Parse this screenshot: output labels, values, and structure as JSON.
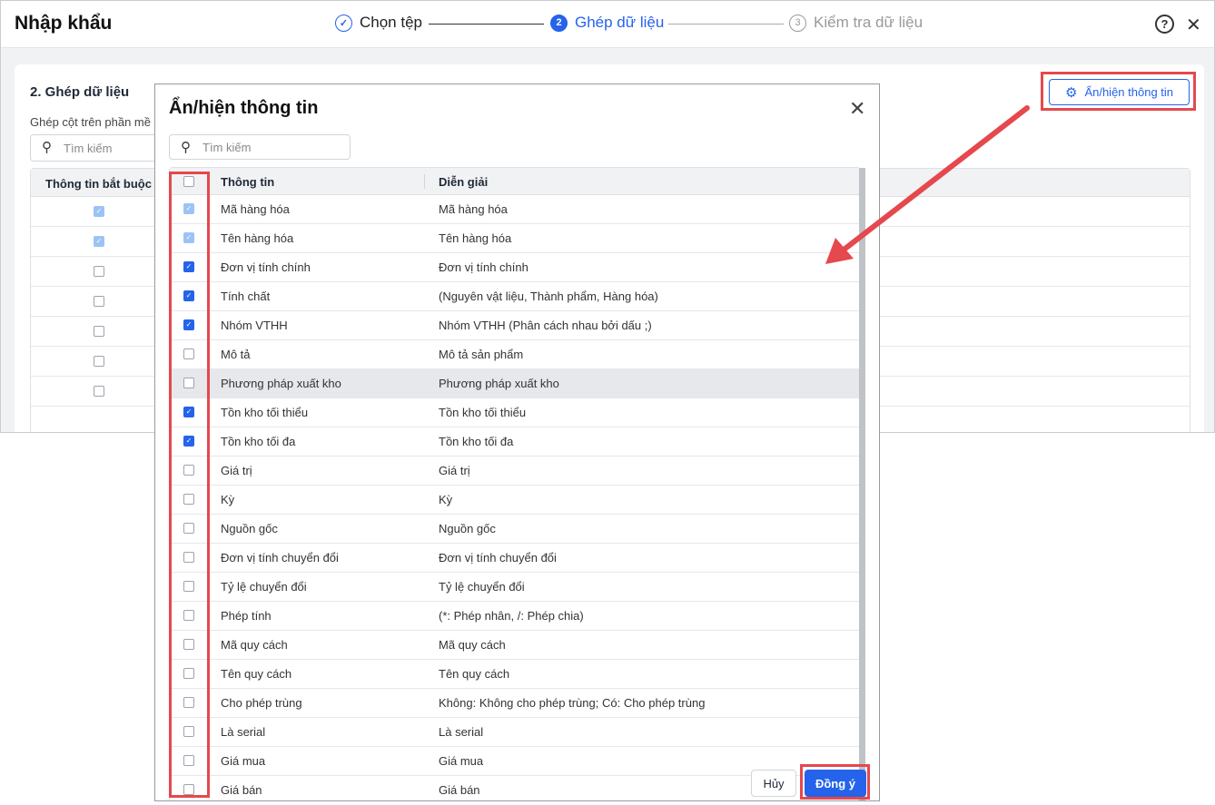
{
  "header": {
    "title": "Nhập khẩu",
    "steps": [
      {
        "num": "✓",
        "label": "Chọn tệp"
      },
      {
        "num": "2",
        "label": "Ghép dữ liệu"
      },
      {
        "num": "3",
        "label": "Kiểm tra dữ liệu"
      }
    ],
    "help": "?",
    "close": "✕"
  },
  "card": {
    "title": "2. Ghép dữ liệu",
    "subtitle": "Ghép cột trên phần mề",
    "search_placeholder": "Tìm kiếm",
    "col_required": "Thông tin bắt buộc",
    "config_button": "Ẩn/hiện thông tin",
    "rows": [
      "disabled",
      "disabled",
      "off",
      "off",
      "off",
      "off",
      "off"
    ]
  },
  "modal": {
    "title": "Ẩn/hiện thông tin",
    "close": "✕",
    "search_placeholder": "Tìm kiếm",
    "col_info": "Thông tin",
    "col_desc": "Diễn giải",
    "cancel": "Hủy",
    "ok": "Đồng ý",
    "rows": [
      {
        "info": "Mã hàng hóa",
        "desc": "Mã hàng hóa",
        "state": "disabled"
      },
      {
        "info": "Tên hàng hóa",
        "desc": "Tên hàng hóa",
        "state": "disabled"
      },
      {
        "info": "Đơn vị tính chính",
        "desc": "Đơn vị tính chính",
        "state": "on"
      },
      {
        "info": "Tính chất",
        "desc": "(Nguyên vật liệu, Thành phẩm, Hàng hóa)",
        "state": "on"
      },
      {
        "info": "Nhóm VTHH",
        "desc": "Nhóm VTHH (Phân cách nhau bởi dấu ;)",
        "state": "on"
      },
      {
        "info": "Mô tả",
        "desc": "Mô tả sản phẩm",
        "state": "off"
      },
      {
        "info": "Phương pháp xuất kho",
        "desc": "Phương pháp xuất kho",
        "state": "off",
        "hover": true
      },
      {
        "info": "Tồn kho tối thiểu",
        "desc": "Tồn kho tối thiểu",
        "state": "on"
      },
      {
        "info": "Tồn kho tối đa",
        "desc": "Tồn kho tối đa",
        "state": "on"
      },
      {
        "info": "Giá trị",
        "desc": "Giá trị",
        "state": "off"
      },
      {
        "info": "Kỳ",
        "desc": "Kỳ",
        "state": "off"
      },
      {
        "info": "Nguồn gốc",
        "desc": "Nguồn gốc",
        "state": "off"
      },
      {
        "info": "Đơn vị tính chuyển đổi",
        "desc": "Đơn vị tính chuyển đổi",
        "state": "off"
      },
      {
        "info": "Tỷ lệ chuyển đổi",
        "desc": "Tỷ lệ chuyển đổi",
        "state": "off"
      },
      {
        "info": "Phép tính",
        "desc": "(*: Phép nhân, /: Phép chia)",
        "state": "off"
      },
      {
        "info": "Mã quy cách",
        "desc": "Mã quy cách",
        "state": "off"
      },
      {
        "info": "Tên quy cách",
        "desc": "Tên quy cách",
        "state": "off"
      },
      {
        "info": "Cho phép trùng",
        "desc": "Không: Không cho phép trùng; Có: Cho phép trùng",
        "state": "off"
      },
      {
        "info": "Là serial",
        "desc": "Là serial",
        "state": "off"
      },
      {
        "info": "Giá mua",
        "desc": "Giá mua",
        "state": "off"
      },
      {
        "info": "Giá bán",
        "desc": "Giá bán",
        "state": "off"
      }
    ]
  },
  "colors": {
    "accent": "#2563eb",
    "annotation": "#e5484d"
  }
}
